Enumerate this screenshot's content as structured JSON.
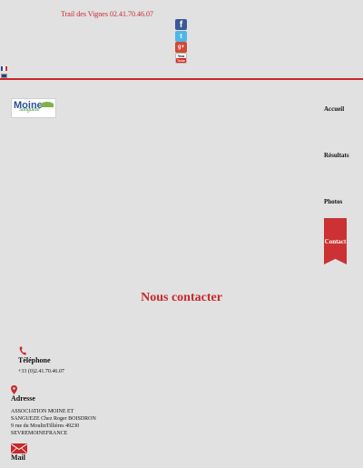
{
  "header": {
    "phone_text": "Trail des Vignes 02.41.70.46.07"
  },
  "social": {
    "facebook": "facebook-icon",
    "twitter": "twitter-icon",
    "google_plus": "google-plus-icon",
    "youtube": "youtube-icon",
    "youtube_you": "You",
    "youtube_tube": "Tube"
  },
  "logo": {
    "main": "Moine",
    "sub": "Sanguèze"
  },
  "nav": {
    "accueil": "Accueil",
    "resultats": "Résultats",
    "photos": "Photos",
    "contact": "Contact"
  },
  "page": {
    "title": "Nous contacter"
  },
  "contact": {
    "telephone_label": "Téléphone",
    "telephone_value": "+33 (0)2.41.70.46.07",
    "address_label": "Adresse",
    "address_lines": [
      "ASSOCIATION MOINE ET",
      "SANGUEZE Chez Roger BOISDRON",
      "9 rue du MoulinTillières 49230",
      "SEVREMOINEFRANCE"
    ],
    "mail_label": "Mail"
  },
  "colors": {
    "accent": "#c8282b",
    "background": "#e1e1e1",
    "nav_active": "#cc3133"
  }
}
